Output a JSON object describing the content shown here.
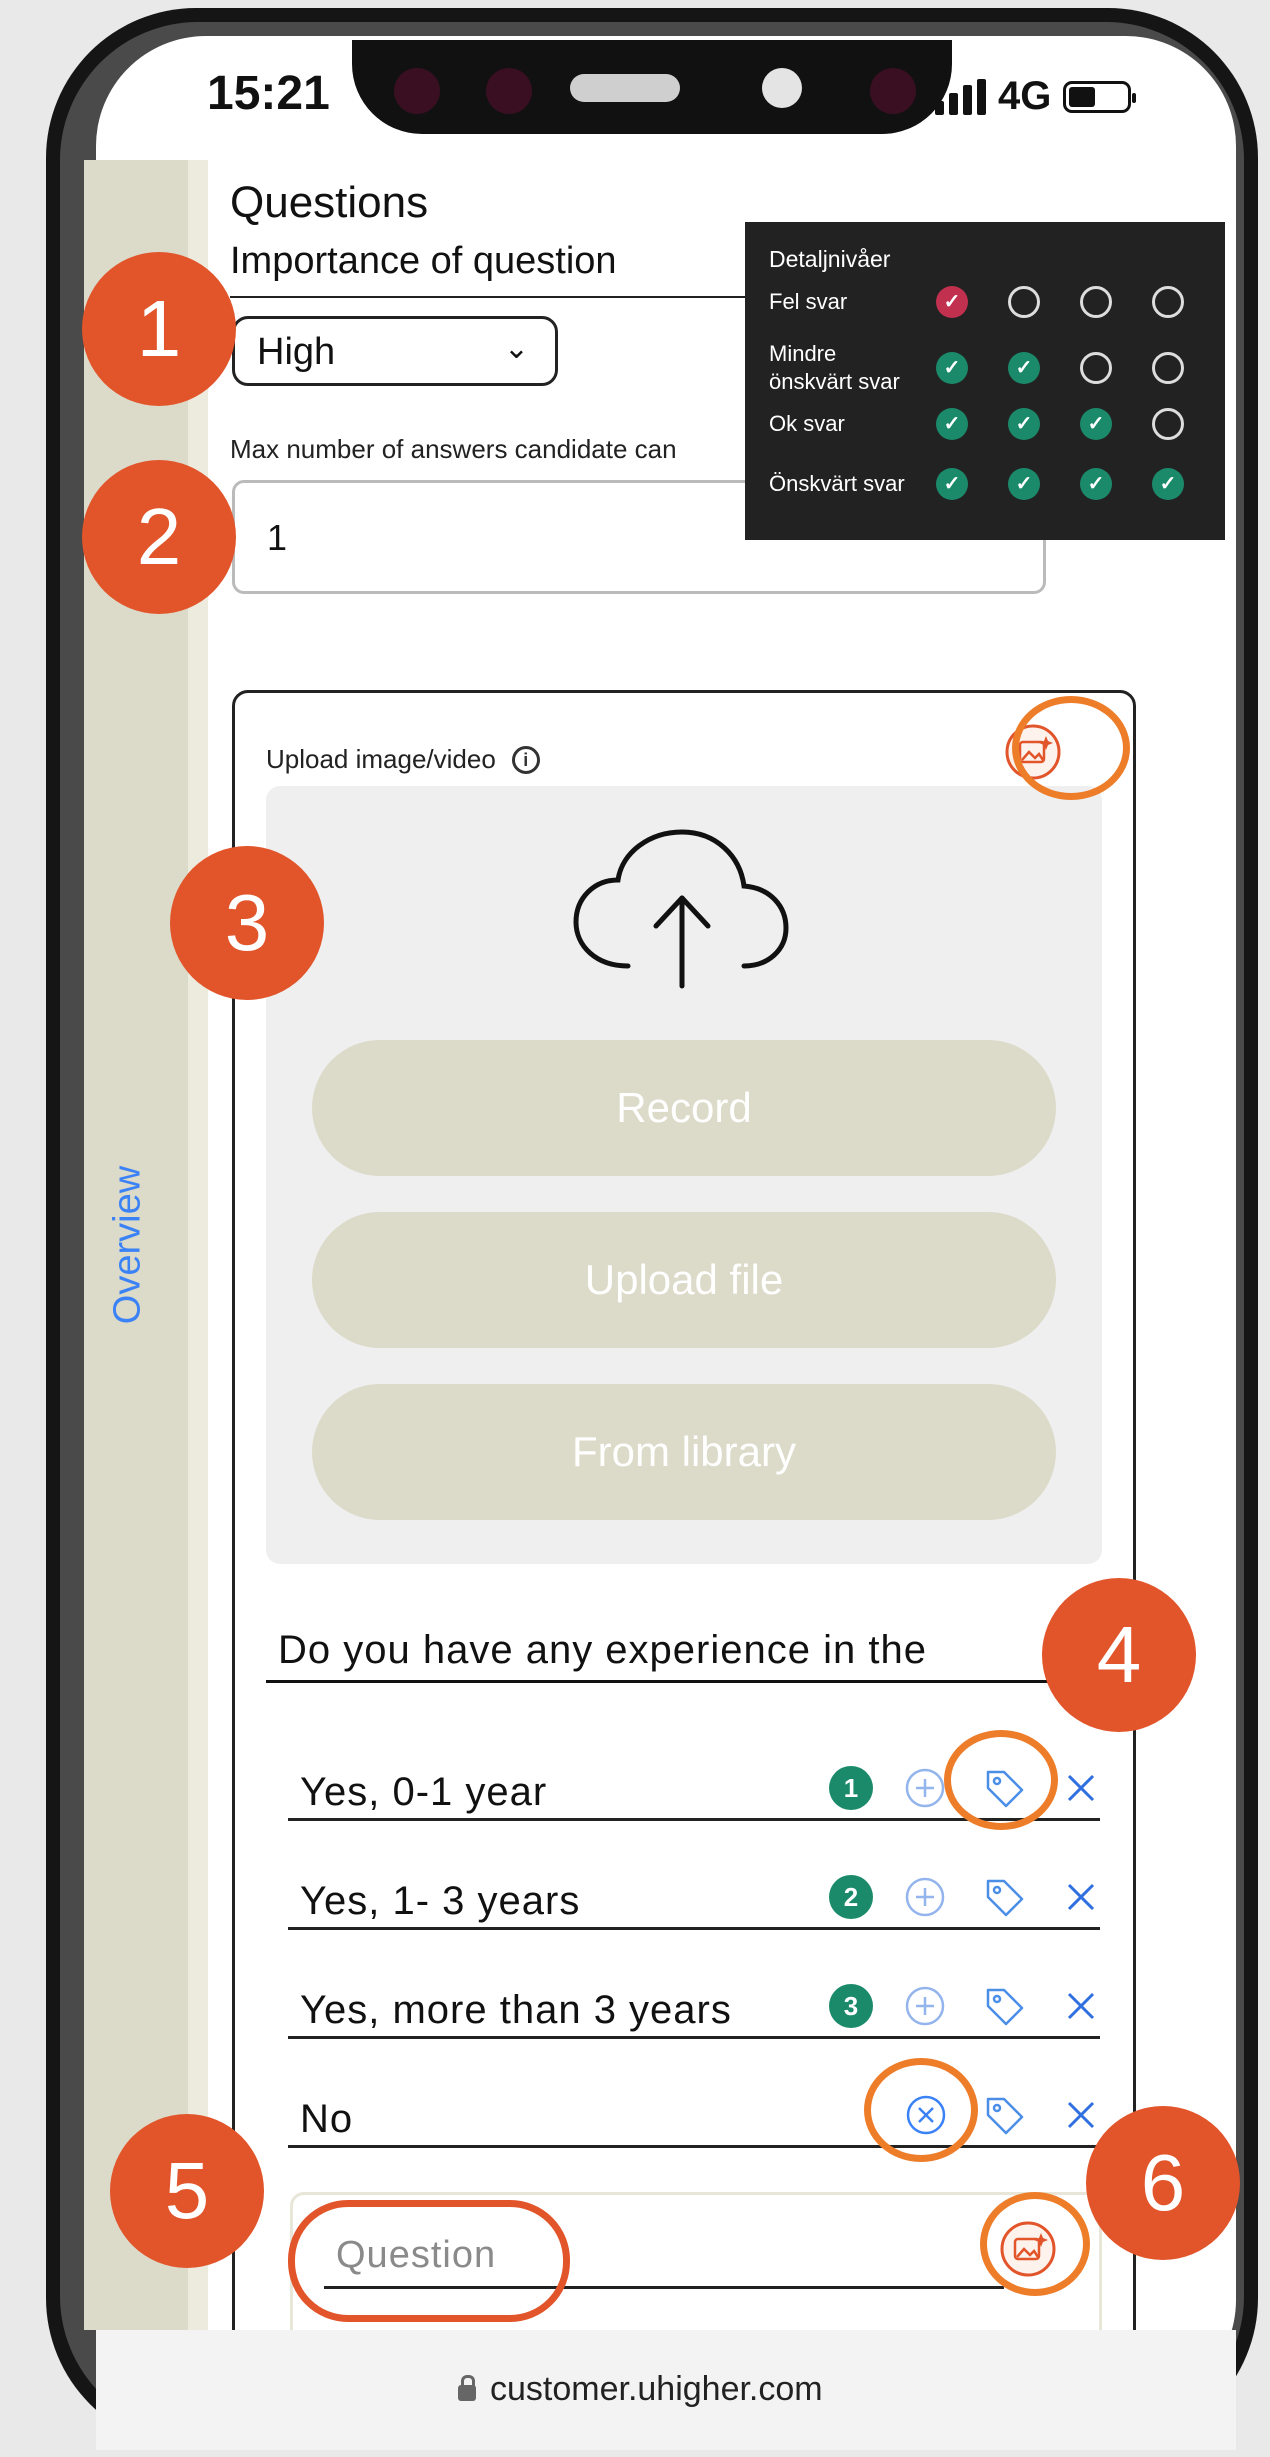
{
  "status_bar": {
    "time": "15:21",
    "network": "4G"
  },
  "sidebar": {
    "overview_label": "Overview"
  },
  "form": {
    "section_title": "Questions",
    "importance_label": "Importance of question",
    "importance_value": "High",
    "max_answers_label": "Max number of answers candidate can",
    "max_answers_value": "1"
  },
  "legend": {
    "title": "Detaljnivåer",
    "rows": [
      {
        "label": "Fel svar",
        "filled": 1,
        "color": "#c2304f"
      },
      {
        "label": "Mindre\nönskvärt svar",
        "filled": 2,
        "color": "#1a8a6a"
      },
      {
        "label": "Ok svar",
        "filled": 3,
        "color": "#1a8a6a"
      },
      {
        "label": "Önskvärt svar",
        "filled": 4,
        "color": "#1a8a6a"
      }
    ]
  },
  "upload": {
    "label": "Upload image/video",
    "record": "Record",
    "upload_file": "Upload file",
    "from_library": "From library"
  },
  "question": {
    "text": "Do you have any experience in the",
    "answers": [
      {
        "text": "Yes, 0-1 year",
        "level": "1"
      },
      {
        "text": "Yes, 1- 3 years",
        "level": "2"
      },
      {
        "text": "Yes, more than 3 years",
        "level": "3"
      },
      {
        "text": "No",
        "level": ""
      }
    ],
    "new_question_placeholder": "Question"
  },
  "url": "customer.uhigher.com",
  "steps": [
    "1",
    "2",
    "3",
    "4",
    "5",
    "6"
  ],
  "colors": {
    "step": "#e2542a",
    "highlight_ring": "#ee7d2a",
    "accent_blue": "#3b82f6",
    "tag_fill": "#dcdac8",
    "badge_green": "#1a8a6a"
  }
}
